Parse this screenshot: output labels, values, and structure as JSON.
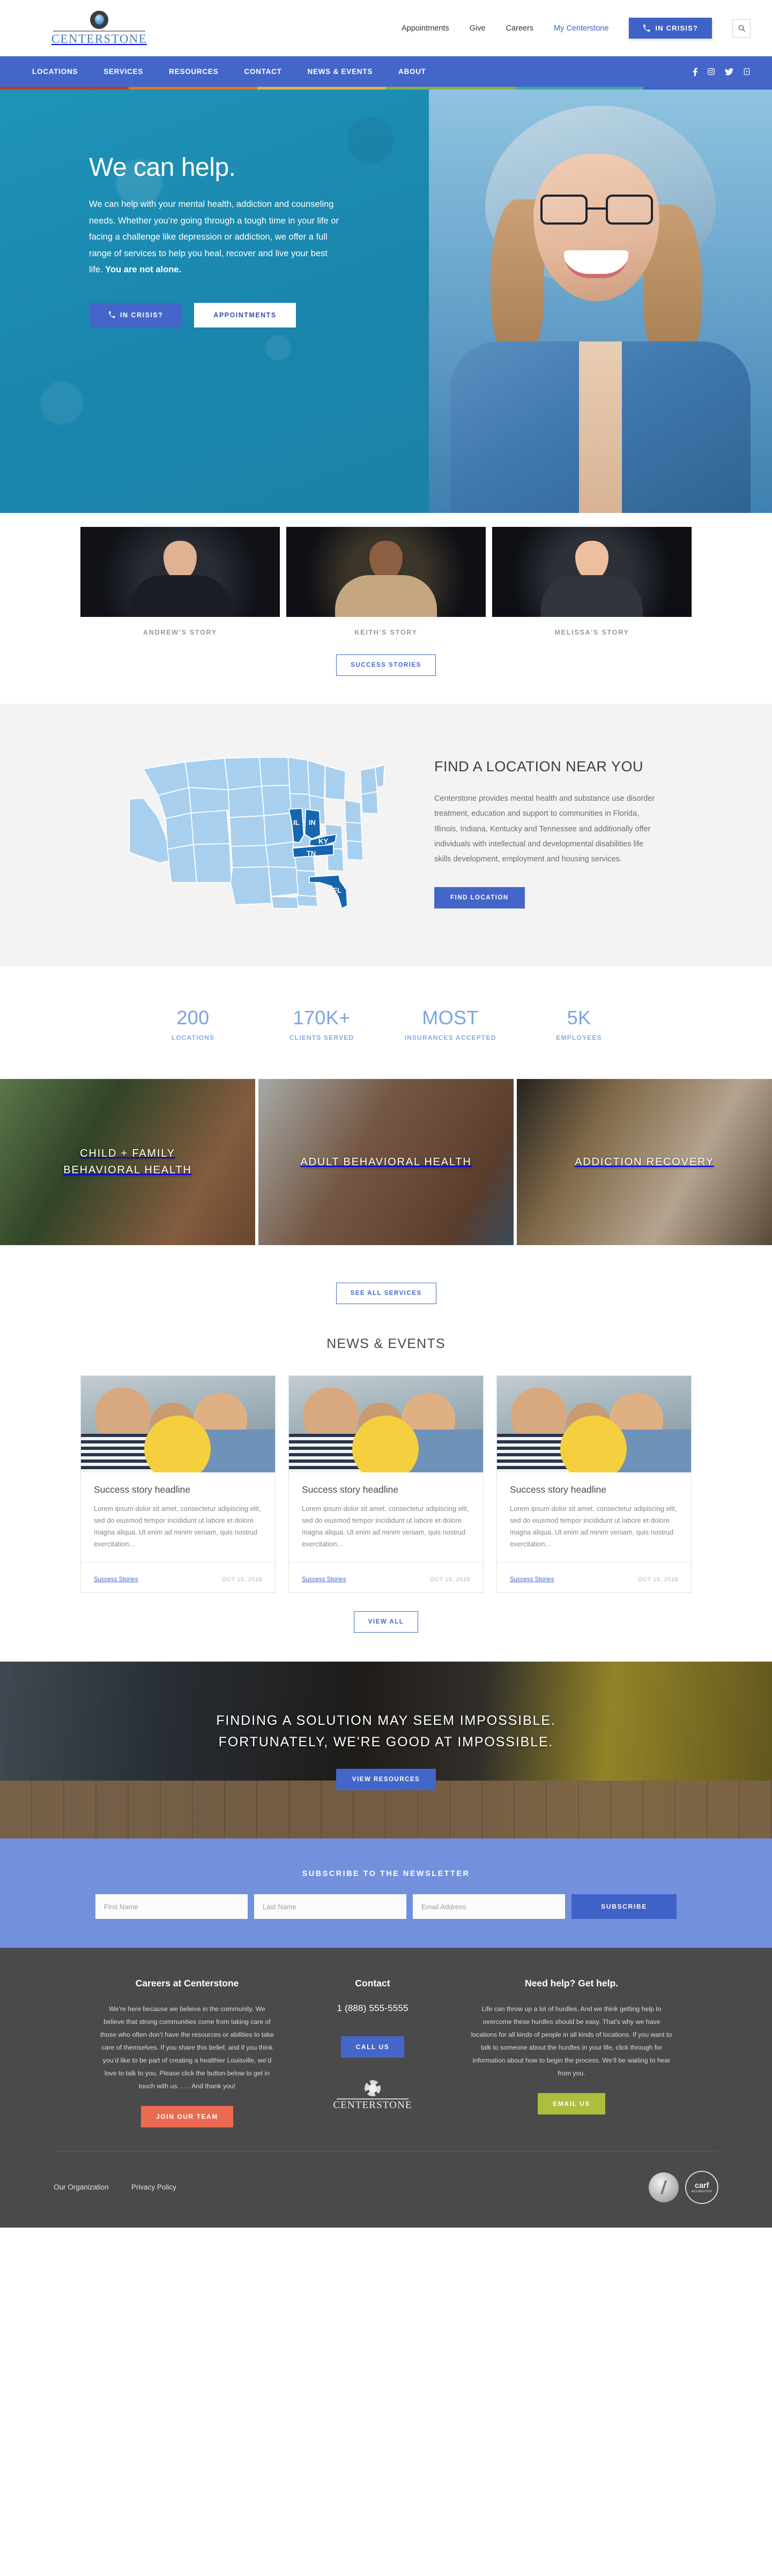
{
  "brand": {
    "name": "CENTERSTONE",
    "logo_icon": "centerstone-compass-logo"
  },
  "topnav": {
    "links": [
      {
        "label": "Appointments",
        "style": "dark"
      },
      {
        "label": "Give",
        "style": "dark"
      },
      {
        "label": "Careers",
        "style": "dark"
      },
      {
        "label": "My Centerstone",
        "style": "blue"
      }
    ],
    "crisis_button": "IN CRISIS?",
    "crisis_icon": "phone-icon",
    "search_icon": "search-icon"
  },
  "mainnav": {
    "items": [
      "LOCATIONS",
      "SERVICES",
      "RESOURCES",
      "CONTACT",
      "NEWS & EVENTS",
      "ABOUT"
    ],
    "socials": [
      "facebook-icon",
      "instagram-icon",
      "twitter-icon",
      "youtube-icon"
    ],
    "bg_color": "#4566c9",
    "accent_colors": [
      "#c0392b",
      "#e8751a",
      "#e3b63c",
      "#8cb23d",
      "#3fa9a0",
      "#3e62c8"
    ]
  },
  "hero": {
    "heading": "We can help.",
    "body_1": "We can help with your mental health, addiction and counseling needs. Whether you’re going through a tough time in your life or facing a challenge like depression or addiction, we offer a full range of services to help you heal, recover and live your best life. ",
    "body_bold": "You are not alone.",
    "btn_crisis": "IN CRISIS?",
    "btn_appointments": "APPOINTMENTS",
    "bg_color": "#1d8fb5"
  },
  "stories": {
    "items": [
      {
        "label": "ANDREW'S STORY"
      },
      {
        "label": "KEITH'S STORY"
      },
      {
        "label": "MELISSA'S STORY"
      }
    ],
    "button": "SUCCESS STORIES"
  },
  "location": {
    "heading": "FIND A LOCATION NEAR YOU",
    "body": "Centerstone provides mental health and substance use disorder treatment, education and support to communities in Florida, Illinois, Indiana, Kentucky and Tennessee and additionally offer individuals with intellectual and developmental disabilities life skills development, employment and housing services.",
    "button": "FIND LOCATION",
    "map": {
      "highlighted_states": [
        "IL",
        "IN",
        "KY",
        "TN",
        "FL"
      ],
      "highlight_color": "#1565b0",
      "base_color": "#a8cfee"
    }
  },
  "stats": [
    {
      "num": "200",
      "lbl": "LOCATIONS"
    },
    {
      "num": "170K+",
      "lbl": "CLIENTS SERVED"
    },
    {
      "num": "MOST",
      "lbl": "INSURANCES ACCEPTED"
    },
    {
      "num": "5K",
      "lbl": "EMPLOYEES"
    }
  ],
  "services": {
    "items": [
      {
        "title": "CHILD + FAMILY BEHAVIORAL HEALTH"
      },
      {
        "title": "ADULT BEHAVIORAL HEALTH"
      },
      {
        "title": "ADDICTION RECOVERY"
      }
    ],
    "button": "SEE ALL SERVICES"
  },
  "news": {
    "heading": "NEWS & EVENTS",
    "cards": [
      {
        "title": "Success story headline",
        "excerpt": "Lorem ipsum dolor sit amet, consectetur adipiscing elit, sed do eiusmod tempor incididunt ut labore et dolore magna aliqua. Ut enim ad minim veniam, quis nostrud exercitation…",
        "tag": "Success Stories",
        "date": "OCT 15, 2018"
      },
      {
        "title": "Success story headline",
        "excerpt": "Lorem ipsum dolor sit amet, consectetur adipiscing elit, sed do eiusmod tempor incididunt ut labore et dolore magna aliqua. Ut enim ad minim veniam, quis nostrud exercitation…",
        "tag": "Success Stories",
        "date": "OCT 15, 2018"
      },
      {
        "title": "Success story headline",
        "excerpt": "Lorem ipsum dolor sit amet, consectetur adipiscing elit, sed do eiusmod tempor incididunt ut labore et dolore magna aliqua. Ut enim ad minim veniam, quis nostrud exercitation…",
        "tag": "Success Stories",
        "date": "OCT 15, 2018"
      }
    ],
    "button": "VIEW ALL"
  },
  "resources": {
    "line_1": "FINDING A SOLUTION MAY SEEM IMPOSSIBLE.",
    "line_2": "FORTUNATELY, WE'RE GOOD AT IMPOSSIBLE.",
    "button": "VIEW RESOURCES"
  },
  "newsletter": {
    "heading": "SUBSCRIBE TO THE NEWSLETTER",
    "first_name_placeholder": "First Name",
    "last_name_placeholder": "Last Name",
    "email_placeholder": "Email Address",
    "first_name_value": "",
    "last_name_value": "",
    "email_value": "",
    "button": "SUBSCRIBE",
    "bg_color": "#7390dd"
  },
  "footer": {
    "careers": {
      "title": "Careers at Centerstone",
      "body": "We’re here because we believe in the community. We believe that strong communities come from taking care of those who often don’t have the resources or abilities to take care of themselves. If you share this belief, and if you think you’d like to be part of creating a healthier Louisville, we’d love to talk to you. Please click the button below to get in touch with us. . . . And thank you!",
      "button": "JOIN OUR TEAM",
      "button_color": "#ec6a52"
    },
    "contact": {
      "title": "Contact",
      "phone": "1 (888) 555-5555",
      "button": "CALL US",
      "button_color": "#4566c9",
      "logo_text": "CENTERSTONE"
    },
    "help": {
      "title": "Need help? Get help.",
      "body": "Life can throw up a lot of hurdles. And we think getting help to overcome these hurdles should be easy. That’s why we have locations for all kinds of people in all kinds of locations. If you want to talk to someone about the hurdles in your life, click through for information about how to begin the process. We’ll be waiting to hear from you.",
      "button": "EMAIL US",
      "button_color": "#adbd3c"
    },
    "bottom_links": [
      "Our Organization",
      "Privacy Policy"
    ],
    "seals": [
      "quality-seal",
      "carf-accredited-seal"
    ],
    "bg_color": "#4a4a4a"
  }
}
